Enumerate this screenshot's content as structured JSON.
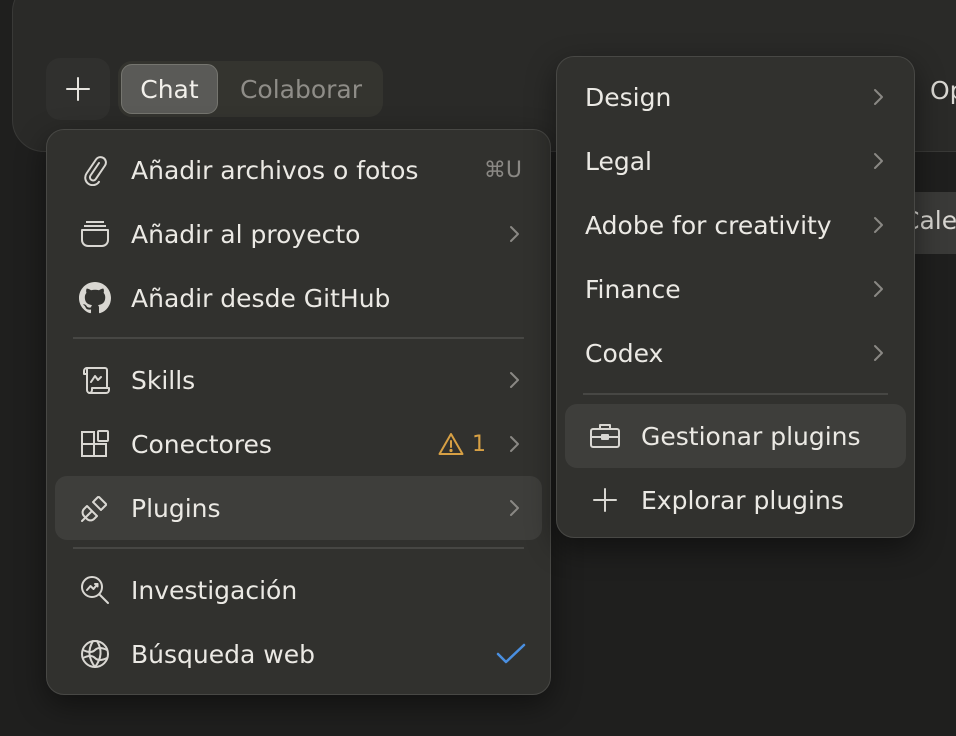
{
  "composer": {
    "mode_tabs": [
      {
        "label": "Chat",
        "active": true
      },
      {
        "label": "Colaborar",
        "active": false
      }
    ],
    "right_overflow_text": "Op",
    "right_chip_text": "Cale"
  },
  "attach_menu": {
    "items": [
      {
        "label": "Añadir archivos o fotos",
        "icon": "paperclip-icon",
        "shortcut": "⌘U"
      },
      {
        "label": "Añadir al proyecto",
        "icon": "project-box-icon",
        "submenu": true
      },
      {
        "label": "Añadir desde GitHub",
        "icon": "github-icon"
      },
      {
        "label": "Skills",
        "icon": "scroll-icon",
        "submenu": true
      },
      {
        "label": "Conectores",
        "icon": "connectors-grid-icon",
        "submenu": true,
        "warning_count": "1"
      },
      {
        "label": "Plugins",
        "icon": "plug-icon",
        "submenu": true,
        "highlighted": true
      },
      {
        "label": "Investigación",
        "icon": "research-magnifier-icon"
      },
      {
        "label": "Búsqueda web",
        "icon": "globe-icon",
        "checked": true
      }
    ]
  },
  "plugins_menu": {
    "categories": [
      {
        "label": "Design"
      },
      {
        "label": "Legal"
      },
      {
        "label": "Adobe for creativity"
      },
      {
        "label": "Finance"
      },
      {
        "label": "Codex"
      }
    ],
    "actions": [
      {
        "label": "Gestionar plugins",
        "icon": "toolbox-icon",
        "highlighted": true
      },
      {
        "label": "Explorar plugins",
        "icon": "plus-icon"
      }
    ]
  },
  "colors": {
    "background": "#1f1f1e",
    "menu_bg": "#31312e",
    "hover_bg": "#3e3e3b",
    "text": "#ebe9e4",
    "warning": "#d7a044",
    "check": "#4a8fe0"
  }
}
